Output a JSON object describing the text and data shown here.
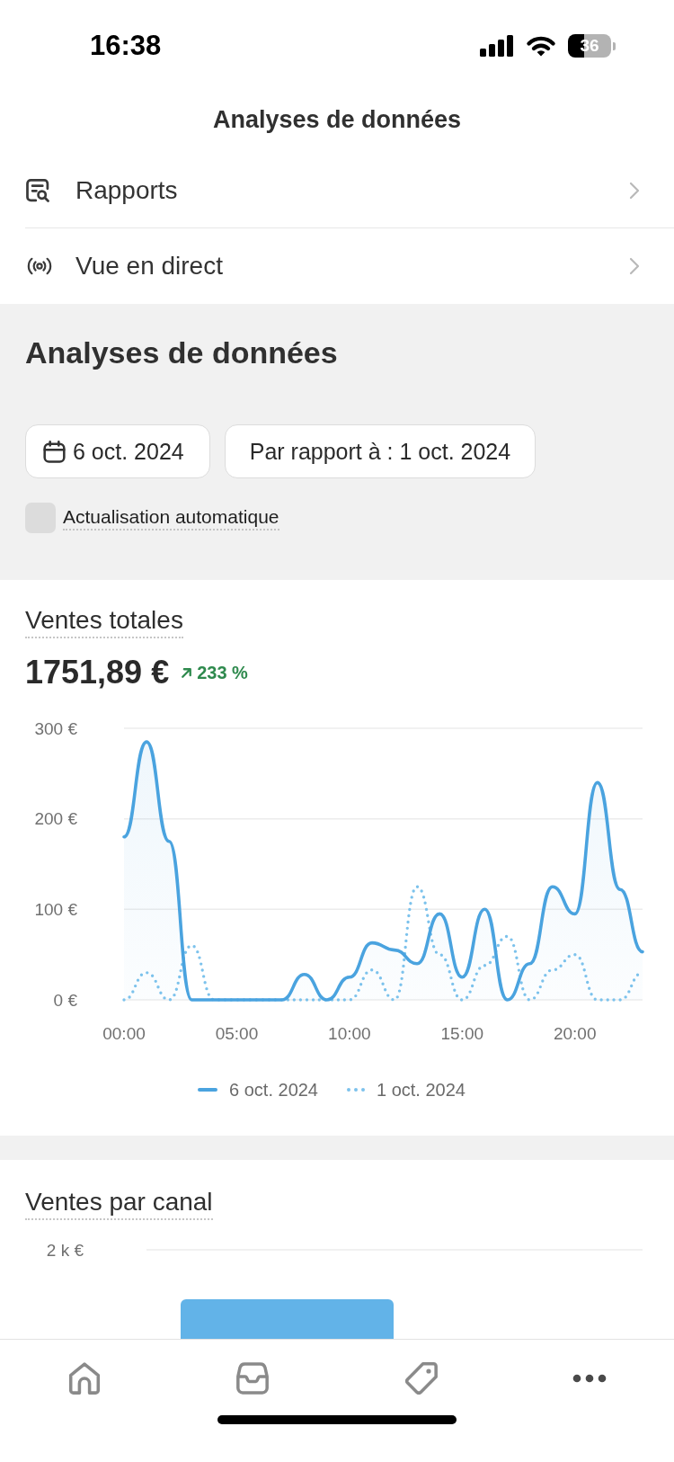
{
  "status_bar": {
    "time": "16:38",
    "battery": "36"
  },
  "header": {
    "title": "Analyses de données"
  },
  "menu": [
    {
      "label": "Rapports"
    },
    {
      "label": "Vue en direct"
    }
  ],
  "overview": {
    "title": "Analyses de données",
    "date_button": "6 oct. 2024",
    "compare_button": "Par rapport à : 1 oct. 2024",
    "auto_refresh": {
      "label": "Actualisation automatique",
      "checked": false
    }
  },
  "total_sales": {
    "title": "Ventes totales",
    "value": "1751,89 €",
    "change": "233 %",
    "increase": true,
    "chart_data": {
      "type": "area",
      "x": [
        0,
        1,
        2,
        3,
        4,
        5,
        6,
        7,
        8,
        9,
        10,
        11,
        12,
        13,
        14,
        15,
        16,
        17,
        18,
        19,
        20,
        21,
        22,
        23
      ],
      "xlim": [
        0,
        23
      ],
      "ylim": [
        0,
        300
      ],
      "xticks": [
        {
          "value": 0,
          "label": "00:00"
        },
        {
          "value": 5,
          "label": "05:00"
        },
        {
          "value": 10,
          "label": "10:00"
        },
        {
          "value": 15,
          "label": "15:00"
        },
        {
          "value": 20,
          "label": "20:00"
        }
      ],
      "yticks": [
        {
          "value": 0,
          "label": "0 €"
        },
        {
          "value": 100,
          "label": "100 €"
        },
        {
          "value": 200,
          "label": "200 €"
        },
        {
          "value": 300,
          "label": "300 €"
        }
      ],
      "series": [
        {
          "name": "6 oct. 2024",
          "color": "#4aa3df",
          "type": "area",
          "line_style": "solid",
          "values": [
            180,
            285,
            175,
            0,
            0,
            0,
            0,
            0,
            28,
            0,
            25,
            63,
            55,
            40,
            95,
            25,
            100,
            0,
            40,
            125,
            95,
            240,
            122,
            53
          ]
        },
        {
          "name": "1 oct. 2024",
          "color": "#7cc2ec",
          "type": "line",
          "line_style": "dotted",
          "values": [
            0,
            30,
            0,
            60,
            0,
            0,
            0,
            0,
            0,
            0,
            0,
            33,
            0,
            125,
            50,
            0,
            38,
            70,
            0,
            33,
            50,
            0,
            0,
            30
          ]
        }
      ]
    }
  },
  "sales_by_channel": {
    "title": "Ventes par canal",
    "axis_label": "2 k €"
  }
}
